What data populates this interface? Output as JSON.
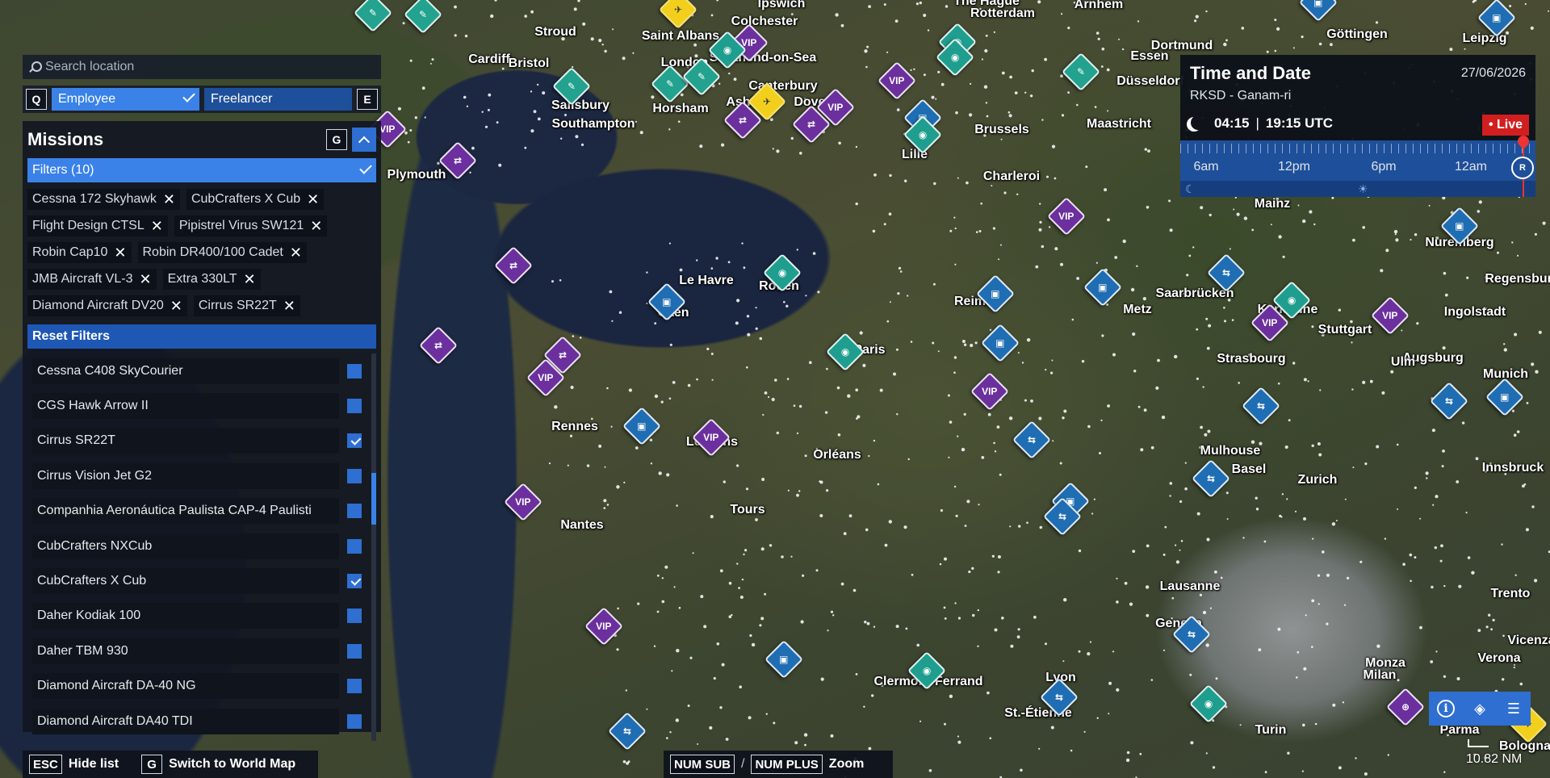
{
  "search": {
    "placeholder": "Search location",
    "icon": "search-icon"
  },
  "modes": {
    "prev_key": "Q",
    "next_key": "E",
    "employee_label": "Employee",
    "freelancer_label": "Freelancer"
  },
  "missions": {
    "title": "Missions",
    "toggle_key": "G",
    "filters_label": "Filters (10)",
    "active_filters": [
      "Cessna 172 Skyhawk",
      "CubCrafters X Cub",
      "Flight Design CTSL",
      "Pipistrel Virus SW121",
      "Robin Cap10",
      "Robin DR400/100 Cadet",
      "JMB Aircraft VL-3",
      "Extra 330LT",
      "Diamond Aircraft DV20",
      "Cirrus SR22T"
    ],
    "reset_label": "Reset Filters",
    "aircraft": [
      {
        "name": "Cessna C408 SkyCourier",
        "checked": false
      },
      {
        "name": "CGS Hawk Arrow II",
        "checked": false
      },
      {
        "name": "Cirrus SR22T",
        "checked": true
      },
      {
        "name": "Cirrus Vision Jet G2",
        "checked": false
      },
      {
        "name": "Companhia Aeronáutica Paulista CAP-4 Paulisti",
        "checked": false
      },
      {
        "name": "CubCrafters NXCub",
        "checked": false
      },
      {
        "name": "CubCrafters X Cub",
        "checked": true
      },
      {
        "name": "Daher Kodiak 100",
        "checked": false
      },
      {
        "name": "Daher TBM 930",
        "checked": false
      },
      {
        "name": "Diamond Aircraft DA-40 NG",
        "checked": false
      },
      {
        "name": "Diamond Aircraft DA40 TDI",
        "checked": false
      }
    ]
  },
  "hints": {
    "hide_key": "ESC",
    "hide_label": "Hide list",
    "switch_key": "G",
    "switch_label": "Switch to World Map",
    "zoom_out_key": "NUM SUB",
    "separator": "/",
    "zoom_in_key": "NUM PLUS",
    "zoom_label": "Zoom"
  },
  "time_date": {
    "title": "Time and Date",
    "date": "27/06/2026",
    "airport": "RKSD - Ganam-ri",
    "local_time": "04:15",
    "utc_time": "19:15 UTC",
    "live_label": "• Live",
    "timeline_labels": [
      "6am",
      "12pm",
      "6pm",
      "12am"
    ],
    "realtime_icon_label": "R"
  },
  "scale": {
    "value": "10.82 NM"
  },
  "cities": [
    "Stroud",
    "Saint Albans",
    "Colchester",
    "Ipswich",
    "Cardiff",
    "Bristol",
    "Southend-on-Sea",
    "London",
    "Salisbury",
    "Horsham",
    "Canterbury",
    "Ashford",
    "Dover",
    "Southampton",
    "Plymouth",
    "The Hague",
    "Rotterdam",
    "Arnhem",
    "Göttingen",
    "Leipzig",
    "Essen",
    "Dortmund",
    "Düsseldorf",
    "Brussels",
    "Maastricht",
    "Lille",
    "Charleroi",
    "Mainz",
    "Nuremberg",
    "Regensburg",
    "Le Havre",
    "Rouen",
    "Caen",
    "Reims",
    "Saarbrücken",
    "Karlsruhe",
    "Metz",
    "Stuttgart",
    "Ingolstadt",
    "Paris",
    "Strasbourg",
    "Augsburg",
    "Ulm",
    "Munich",
    "Rennes",
    "Le Mans",
    "Orléans",
    "Mulhouse",
    "Basel",
    "Zurich",
    "Innsbruck",
    "Nantes",
    "Tours",
    "Lausanne",
    "Geneva",
    "Trento",
    "Verona",
    "Vicenza",
    "Monza",
    "Milan",
    "Clermont-Ferrand",
    "Lyon",
    "St.-Étienne",
    "Turin",
    "Parma",
    "Bologna"
  ]
}
